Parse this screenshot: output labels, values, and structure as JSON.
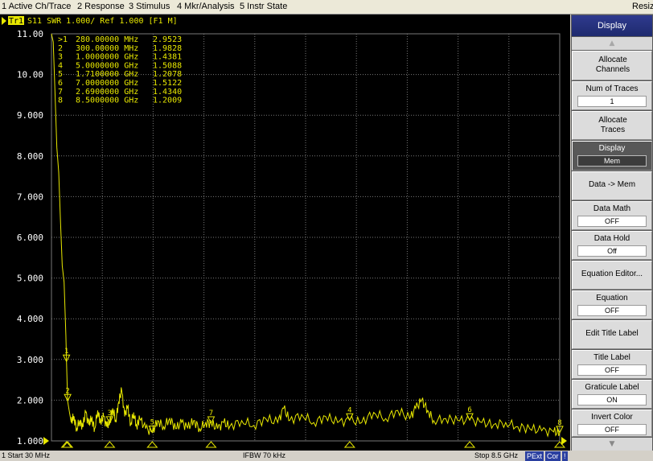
{
  "menu": [
    "1 Active Ch/Trace",
    "2 Response",
    "3 Stimulus",
    "4 Mkr/Analysis",
    "5 Instr State",
    "Resize"
  ],
  "trace_header": {
    "tag": "Tr1",
    "text": "S11  SWR 1.000/  Ref 1.000  [F1 M]"
  },
  "softkeys": {
    "title": "Display",
    "items": [
      {
        "label": "Allocate Channels",
        "value": null
      },
      {
        "label": "Num of Traces",
        "value": "1"
      },
      {
        "label": "Allocate Traces",
        "value": null
      },
      {
        "label": "Display",
        "value": "Mem"
      },
      {
        "label": "Data -> Mem",
        "value": null
      },
      {
        "label": "Data Math",
        "value": "OFF"
      },
      {
        "label": "Data Hold",
        "value": "Off"
      },
      {
        "label": "Equation Editor...",
        "value": null
      },
      {
        "label": "Equation",
        "value": "OFF"
      },
      {
        "label": "Edit Title Label",
        "value": null
      },
      {
        "label": "Title Label",
        "value": "OFF"
      },
      {
        "label": "Graticule Label",
        "value": "ON"
      },
      {
        "label": "Invert Color",
        "value": "OFF"
      }
    ]
  },
  "status": {
    "left": "1  Start 30 MHz",
    "center": "IFBW 70 kHz",
    "right": "Stop 8.5 GHz",
    "badge_pext": "PExt",
    "badge_cor": "Cor",
    "badge_excl": "!"
  },
  "colors": {
    "trace": "#e8e800",
    "grid": "#777777",
    "background": "#000000",
    "softkey_title": "#1e2a6e",
    "pext_badge": "#2a3fa0",
    "cor_badge": "#2a3fa0"
  },
  "chart_data": {
    "type": "line",
    "title": "S11  SWR 1.000/  Ref 1.000  [F1 M]",
    "ylabel": "",
    "xlabel": "",
    "xlim": [
      0.03,
      8.5
    ],
    "x_unit": "GHz",
    "ylim": [
      1.0,
      11.0
    ],
    "y_tick_labels": [
      "11.00",
      "10.00",
      "9.000",
      "8.000",
      "7.000",
      "6.000",
      "5.000",
      "4.000",
      "3.000",
      "2.000",
      "1.000"
    ],
    "y_ticks": [
      11,
      10,
      9,
      8,
      7,
      6,
      5,
      4,
      3,
      2,
      1
    ],
    "grid": true,
    "markers": [
      {
        "id": "1",
        "freq_text": "280.00000 MHz",
        "value_text": "2.9523",
        "x": 0.28,
        "y": 2.9523
      },
      {
        "id": "2",
        "freq_text": "300.00000 MHz",
        "value_text": "1.9828",
        "x": 0.3,
        "y": 1.9828
      },
      {
        "id": "3",
        "freq_text": "1.0000000 GHz",
        "value_text": "1.4381",
        "x": 1.0,
        "y": 1.4381
      },
      {
        "id": "4",
        "freq_text": "5.0000000 GHz",
        "value_text": "1.5088",
        "x": 5.0,
        "y": 1.5088
      },
      {
        "id": "5",
        "freq_text": "1.7100000 GHz",
        "value_text": "1.2078",
        "x": 1.71,
        "y": 1.2078
      },
      {
        "id": "6",
        "freq_text": "7.0000000 GHz",
        "value_text": "1.5122",
        "x": 7.0,
        "y": 1.5122
      },
      {
        "id": "7",
        "freq_text": "2.6900000 GHz",
        "value_text": "1.4340",
        "x": 2.69,
        "y": 1.434
      },
      {
        "id": "8",
        "freq_text": "8.5000000 GHz",
        "value_text": "1.2009",
        "x": 8.5,
        "y": 1.2009
      }
    ],
    "series": [
      {
        "values": [
          [
            0.03,
            11.0
          ],
          [
            0.06,
            10.8
          ],
          [
            0.09,
            9.5
          ],
          [
            0.12,
            8.2
          ],
          [
            0.15,
            7.6
          ],
          [
            0.18,
            6.4
          ],
          [
            0.21,
            5.3
          ],
          [
            0.24,
            4.9
          ],
          [
            0.27,
            3.6
          ],
          [
            0.28,
            2.95
          ],
          [
            0.3,
            1.98
          ],
          [
            0.33,
            1.7
          ],
          [
            0.36,
            1.45
          ],
          [
            0.4,
            1.6
          ],
          [
            0.45,
            1.3
          ],
          [
            0.5,
            1.5
          ],
          [
            0.55,
            1.35
          ],
          [
            0.6,
            1.7
          ],
          [
            0.65,
            1.4
          ],
          [
            0.7,
            1.55
          ],
          [
            0.75,
            1.3
          ],
          [
            0.8,
            1.75
          ],
          [
            0.85,
            1.45
          ],
          [
            0.9,
            1.6
          ],
          [
            0.95,
            1.35
          ],
          [
            1.0,
            1.44
          ],
          [
            1.05,
            1.8
          ],
          [
            1.1,
            1.5
          ],
          [
            1.15,
            1.95
          ],
          [
            1.2,
            2.25
          ],
          [
            1.25,
            1.6
          ],
          [
            1.3,
            1.85
          ],
          [
            1.35,
            1.4
          ],
          [
            1.4,
            1.7
          ],
          [
            1.45,
            1.35
          ],
          [
            1.5,
            1.55
          ],
          [
            1.6,
            1.3
          ],
          [
            1.71,
            1.21
          ],
          [
            1.8,
            1.5
          ],
          [
            1.9,
            1.35
          ],
          [
            2.0,
            1.55
          ],
          [
            2.1,
            1.3
          ],
          [
            2.2,
            1.45
          ],
          [
            2.3,
            1.32
          ],
          [
            2.4,
            1.5
          ],
          [
            2.5,
            1.3
          ],
          [
            2.6,
            1.45
          ],
          [
            2.69,
            1.43
          ],
          [
            2.8,
            1.3
          ],
          [
            2.9,
            1.45
          ],
          [
            3.0,
            1.35
          ],
          [
            3.2,
            1.5
          ],
          [
            3.4,
            1.38
          ],
          [
            3.6,
            1.55
          ],
          [
            3.8,
            1.45
          ],
          [
            3.9,
            1.8
          ],
          [
            4.0,
            1.5
          ],
          [
            4.2,
            1.65
          ],
          [
            4.4,
            1.45
          ],
          [
            4.6,
            1.6
          ],
          [
            4.8,
            1.45
          ],
          [
            5.0,
            1.51
          ],
          [
            5.2,
            1.45
          ],
          [
            5.4,
            1.7
          ],
          [
            5.6,
            1.55
          ],
          [
            5.8,
            1.75
          ],
          [
            6.0,
            1.55
          ],
          [
            6.1,
            1.8
          ],
          [
            6.2,
            2.0
          ],
          [
            6.3,
            1.75
          ],
          [
            6.4,
            1.5
          ],
          [
            6.6,
            1.55
          ],
          [
            6.8,
            1.5
          ],
          [
            7.0,
            1.51
          ],
          [
            7.2,
            1.45
          ],
          [
            7.4,
            1.4
          ],
          [
            7.6,
            1.45
          ],
          [
            7.8,
            1.35
          ],
          [
            8.0,
            1.3
          ],
          [
            8.2,
            1.25
          ],
          [
            8.4,
            1.22
          ],
          [
            8.5,
            1.2
          ]
        ]
      }
    ]
  }
}
